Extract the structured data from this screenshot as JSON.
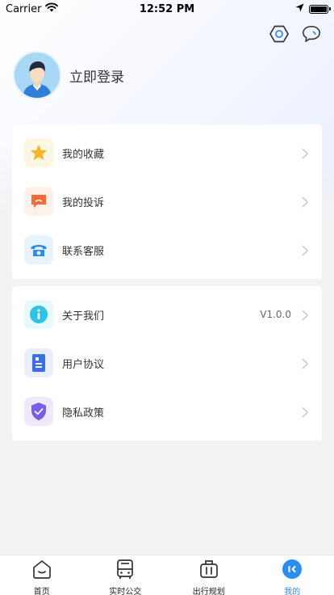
{
  "status_bar": {
    "carrier": "Carrier",
    "time": "12:52 PM"
  },
  "header": {
    "icons": [
      "settings-icon",
      "message-icon"
    ]
  },
  "profile": {
    "login_label": "立即登录"
  },
  "menu_groups": [
    {
      "items": [
        {
          "label": "我的收藏",
          "icon": "star-icon",
          "icon_bg": "#fff7e3",
          "icon_color": "#f7b52b"
        },
        {
          "label": "我的投诉",
          "icon": "complaint-icon",
          "icon_bg": "#fff0ea",
          "icon_color": "#f06a3a"
        },
        {
          "label": "联系客服",
          "icon": "phone-icon",
          "icon_bg": "#e7f4ff",
          "icon_color": "#2d8cf0"
        }
      ]
    },
    {
      "items": [
        {
          "label": "关于我们",
          "value": "V1.0.0",
          "icon": "info-icon",
          "icon_bg": "#e6f9fd",
          "icon_color": "#2cc3e6"
        },
        {
          "label": "用户协议",
          "icon": "document-icon",
          "icon_bg": "#e9efff",
          "icon_color": "#3d6fe0"
        },
        {
          "label": "隐私政策",
          "icon": "shield-icon",
          "icon_bg": "#eee9ff",
          "icon_color": "#7a5ce8"
        }
      ]
    }
  ],
  "tabbar": {
    "tabs": [
      {
        "label": "首页",
        "icon": "home-icon"
      },
      {
        "label": "实时公交",
        "icon": "bus-icon"
      },
      {
        "label": "出行规划",
        "icon": "luggage-icon"
      },
      {
        "label": "我的",
        "icon": "profile-icon",
        "active": true
      }
    ]
  },
  "colors": {
    "accent": "#2d8cf0",
    "page_bg": "#f2f2f4"
  }
}
